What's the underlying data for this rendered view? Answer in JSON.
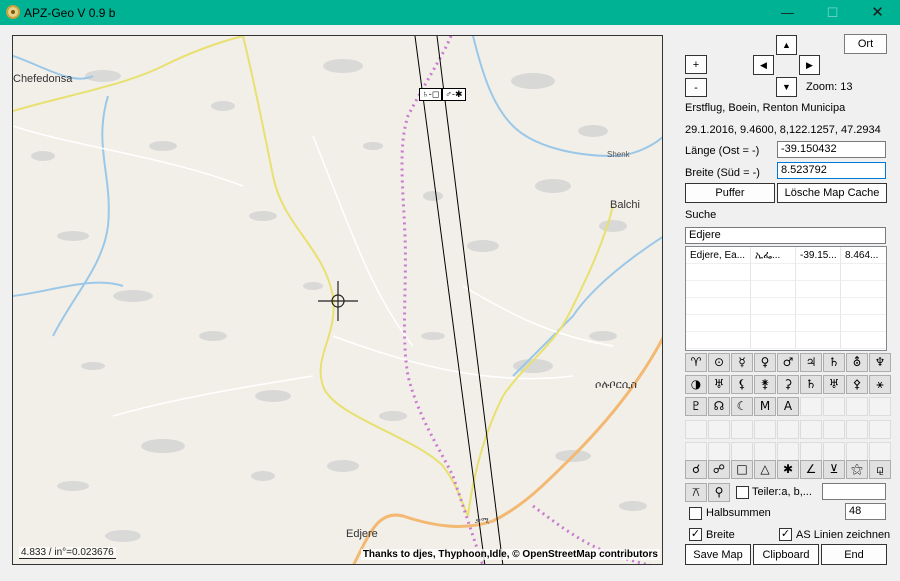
{
  "window": {
    "title": "APZ-Geo V 0.9 b",
    "minimize": "—",
    "maximize": "☐",
    "close": "✕"
  },
  "map": {
    "places": [
      "Chefedonsa",
      "Shenk",
      "Balchi",
      "ሶሉቦርሲስ",
      "Edjere",
      "ቃሚ"
    ],
    "symbols": [
      "♄-◻",
      "♂-✱"
    ],
    "scale_text": "4.833 / in°=0.023676",
    "attribution": "Thanks to djes, Thyphoon,Idle,  © OpenStreetMap contributors"
  },
  "controls": {
    "ort": "Ort",
    "up": "▲",
    "left": "◀",
    "right": "▶",
    "down": "▼",
    "zoom_in": "+",
    "zoom_out": "-",
    "zoom": "Zoom: 13",
    "info1": "Erstflug, Boein, Renton Municipa",
    "info2": "29.1.2016, 9.4600, 8,122.1257, 47.2934",
    "laenge_label": "Länge  (Ost = -)",
    "laenge_value": "-39.150432",
    "breite_label": "Breite (Süd = -)",
    "breite_value": "8.523792",
    "puffer": "Puffer",
    "clear_cache": "Lösche Map Cache",
    "suche_label": "Suche",
    "suche_value": "Edjere"
  },
  "results": [
    [
      "Edjere, Ea...",
      "ኢፌ...",
      "-39.15...",
      "8.464..."
    ]
  ],
  "glyphs": {
    "row1": [
      "♈",
      "⊙",
      "☿",
      "♀",
      "♂",
      "♃",
      "♄",
      "⛢",
      "♆"
    ],
    "row2": [
      "◑",
      "♅",
      "⚸",
      "⚵",
      "⚳",
      "♄",
      "♅",
      "⚴",
      "⚹"
    ],
    "row3": [
      "♇",
      "☊",
      "☾",
      "M",
      "A"
    ],
    "row4": [
      "☌",
      "☍",
      "□",
      "△",
      "✱",
      "∠",
      "⊻",
      "⚝",
      "⚼"
    ],
    "row5": [
      "⚻",
      "⚲"
    ]
  },
  "options": {
    "teiler": "Teiler:a, b,...",
    "halbsummen": "Halbsummen",
    "halbsummen_value": "48",
    "breite": "Breite",
    "as_linien": "AS Linien zeichnen",
    "check": "✓"
  },
  "buttons": {
    "save_map": "Save Map",
    "clipboard": "Clipboard",
    "end": "End"
  }
}
